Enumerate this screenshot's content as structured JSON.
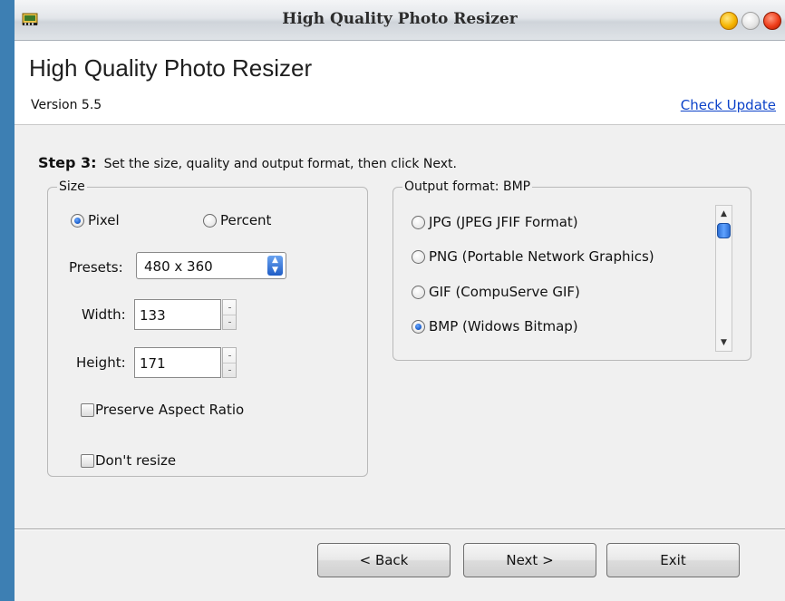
{
  "window": {
    "title": "High Quality Photo Resizer",
    "app_icon": "photo-resizer-app-icon",
    "buttons": [
      "minimize-icon",
      "maximize-icon",
      "close-icon"
    ]
  },
  "header": {
    "app_title": "High Quality Photo Resizer",
    "version": "Version 5.5",
    "check_update": "Check Update"
  },
  "step": {
    "label": "Step 3:",
    "instruction": "Set the size, quality and output format, then click Next."
  },
  "size_group": {
    "legend": "Size",
    "pixel_label": "Pixel",
    "percent_label": "Percent",
    "unit_selected": "Pixel",
    "presets_label": "Presets:",
    "presets_value": "480 x 360",
    "width_label": "Width:",
    "width_value": "133",
    "height_label": "Height:",
    "height_value": "171",
    "preserve_aspect_label": "Preserve Aspect Ratio",
    "preserve_aspect_checked": false,
    "dont_resize_label": "Don't resize",
    "dont_resize_checked": false
  },
  "output_group": {
    "legend": "Output format: BMP",
    "options": [
      {
        "label": "JPG (JPEG JFIF Format)",
        "selected": false
      },
      {
        "label": "PNG (Portable Network Graphics)",
        "selected": false
      },
      {
        "label": "GIF (CompuServe GIF)",
        "selected": false
      },
      {
        "label": "BMP (Widows Bitmap)",
        "selected": true
      }
    ]
  },
  "footer": {
    "back_label": "< Back",
    "next_label": "Next >",
    "exit_label": "Exit"
  },
  "colors": {
    "link": "#0b42c9",
    "radio_selected": "#1659c7",
    "scroll_thumb": "#2c6ed4"
  }
}
